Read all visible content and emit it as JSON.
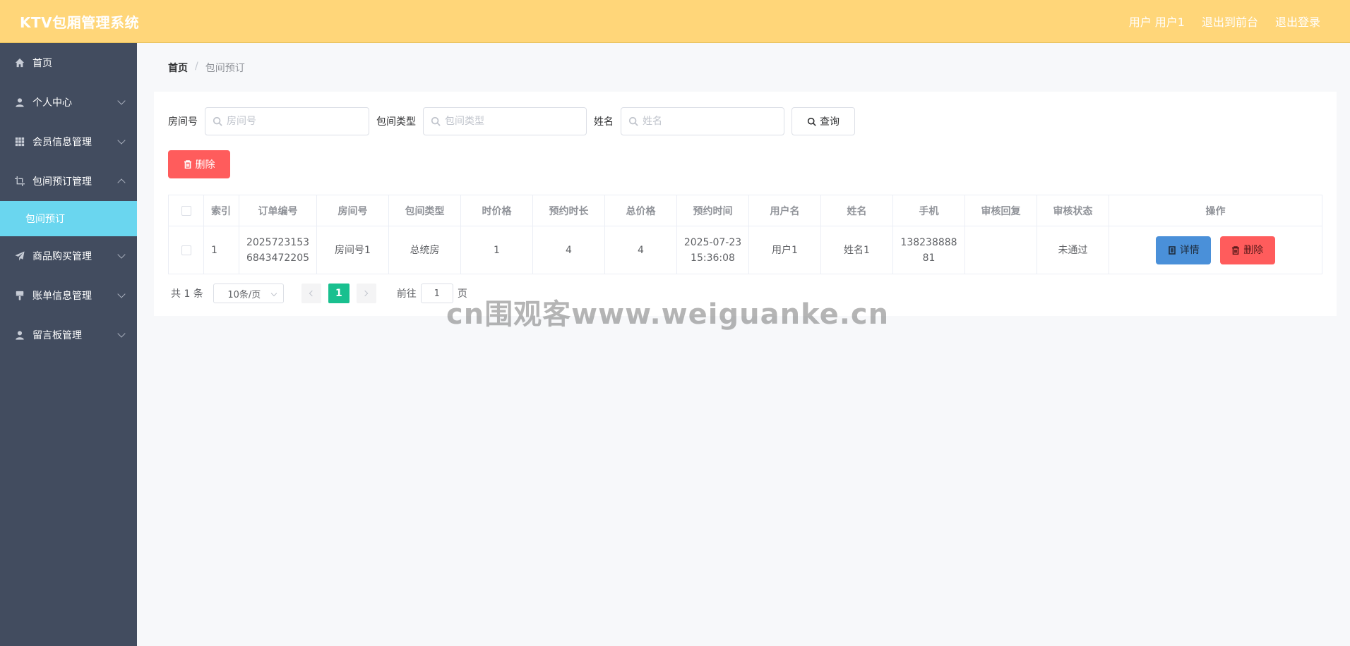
{
  "header": {
    "title": "KTV包厢管理系统",
    "user_label": "用户 用户1",
    "to_front_label": "退出到前台",
    "logout_label": "退出登录"
  },
  "sidebar": {
    "items": [
      {
        "label": "首页",
        "icon": "home-icon"
      },
      {
        "label": "个人中心",
        "icon": "user-icon"
      },
      {
        "label": "会员信息管理",
        "icon": "grid-icon"
      },
      {
        "label": "包间预订管理",
        "icon": "crop-icon",
        "expanded": true
      },
      {
        "label": "商品购买管理",
        "icon": "send-icon"
      },
      {
        "label": "账单信息管理",
        "icon": "brush-icon"
      },
      {
        "label": "留言板管理",
        "icon": "user-icon"
      }
    ],
    "active_sub": "包间预订"
  },
  "breadcrumb": {
    "home": "首页",
    "separator": "/",
    "current": "包间预订"
  },
  "search": {
    "room_label": "房间号",
    "room_placeholder": "房间号",
    "type_label": "包间类型",
    "type_placeholder": "包间类型",
    "name_label": "姓名",
    "name_placeholder": "姓名",
    "query_label": "查询"
  },
  "batch_delete_label": "删除",
  "table": {
    "columns": [
      "索引",
      "订单编号",
      "房间号",
      "包间类型",
      "时价格",
      "预约时长",
      "总价格",
      "预约时间",
      "用户名",
      "姓名",
      "手机",
      "审核回复",
      "审核状态",
      "操作"
    ],
    "rows": [
      {
        "index": "1",
        "order_no_l1": "2025723153",
        "order_no_l2": "6843472205",
        "room": "房间号1",
        "type": "总统房",
        "hour_price": "1",
        "duration": "4",
        "total": "4",
        "time_l1": "2025-07-23",
        "time_l2": "15:36:08",
        "username": "用户1",
        "name": "姓名1",
        "phone_l1": "138238888",
        "phone_l2": "81",
        "reply": "",
        "status": "未通过",
        "detail_label": "详情",
        "delete_label": "删除"
      }
    ]
  },
  "pagination": {
    "total": "共 1 条",
    "page_size": "10条/页",
    "current_page": "1",
    "goto_prefix": "前往",
    "goto_value": "1",
    "goto_suffix": "页"
  },
  "watermark": "cn围观客www.weiguanke.cn",
  "colors": {
    "header_bg": "#ffd679",
    "sidebar_bg": "#424c5f",
    "sidebar_active": "#6ad6ef",
    "danger": "#ff5c5c",
    "primary": "#4a90d9",
    "page_active": "#19c08f"
  }
}
